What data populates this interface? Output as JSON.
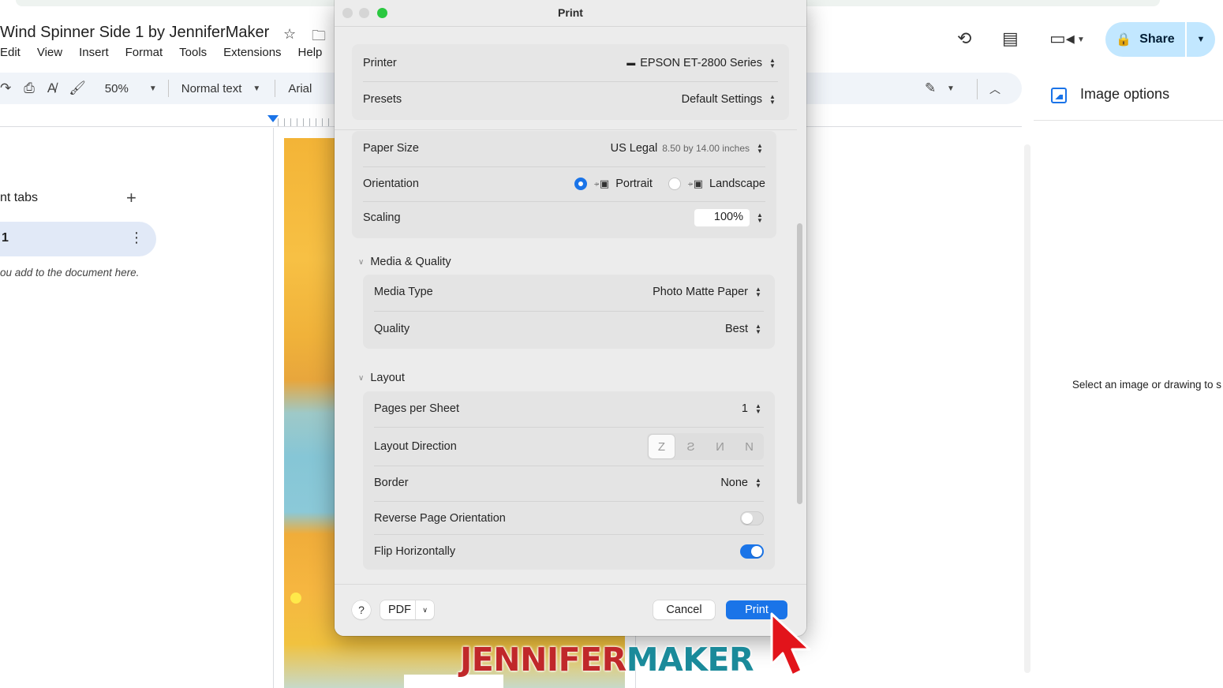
{
  "docs": {
    "title": "Wind Spinner Side 1 by JenniferMaker",
    "menu": [
      "Edit",
      "View",
      "Insert",
      "Format",
      "Tools",
      "Extensions",
      "Help"
    ],
    "toolbar": {
      "zoom": "50%",
      "style": "Normal text",
      "font": "Arial"
    },
    "tabs_panel": {
      "label": "nt tabs",
      "tab_number": "1",
      "hint": "ou add to the document here."
    },
    "share_label": "Share",
    "image_options": {
      "title": "Image options",
      "hint": "Select an image or drawing to s options."
    },
    "icons": [
      "star-icon",
      "move-folder-icon",
      "history-icon",
      "comment-icon",
      "meet-icon",
      "lock-icon",
      "print-icon",
      "spellcheck-icon",
      "paint-format-icon",
      "redo-icon",
      "edit-mode-icon",
      "collapse-icon",
      "image-icon"
    ]
  },
  "dialog": {
    "title": "Print",
    "printer": {
      "label": "Printer",
      "value": "EPSON ET-2800 Series"
    },
    "presets": {
      "label": "Presets",
      "value": "Default Settings"
    },
    "paper_size": {
      "label": "Paper Size",
      "value": "US Legal",
      "detail": "8.50 by 14.00 inches"
    },
    "orientation": {
      "label": "Orientation",
      "options": [
        "Portrait",
        "Landscape"
      ],
      "selected": "Portrait"
    },
    "scaling": {
      "label": "Scaling",
      "value": "100%"
    },
    "media_quality": {
      "header": "Media & Quality",
      "media_type": {
        "label": "Media Type",
        "value": "Photo Matte Paper"
      },
      "quality": {
        "label": "Quality",
        "value": "Best"
      }
    },
    "layout": {
      "header": "Layout",
      "pages_per_sheet": {
        "label": "Pages per Sheet",
        "value": "1"
      },
      "layout_direction": {
        "label": "Layout Direction",
        "options": [
          "Z",
          "S",
          "N-reverse",
          "N"
        ],
        "selected": "Z"
      },
      "border": {
        "label": "Border",
        "value": "None"
      },
      "reverse_orientation": {
        "label": "Reverse Page Orientation",
        "on": false
      },
      "flip_horizontally": {
        "label": "Flip Horizontally",
        "on": true
      }
    },
    "footer": {
      "help": "?",
      "pdf": "PDF",
      "cancel": "Cancel",
      "print": "Print"
    }
  },
  "watermark": {
    "part1": "JENNIFER",
    "part2": "MAKER"
  },
  "colors": {
    "accent": "#1a74e8",
    "share_bg": "#c2e7ff",
    "watermark_red": "#c0282a",
    "watermark_teal": "#1a8a9a"
  }
}
